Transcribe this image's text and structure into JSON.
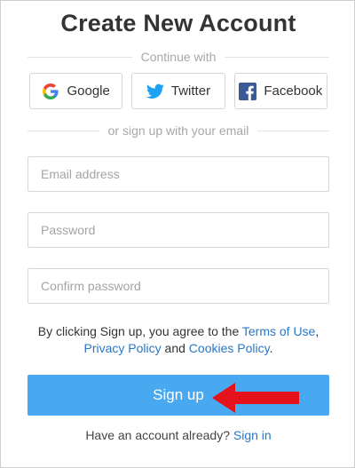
{
  "title": "Create New Account",
  "continue_with": "Continue with",
  "social": {
    "google": "Google",
    "twitter": "Twitter",
    "facebook": "Facebook"
  },
  "or_signup": "or sign up with your email",
  "fields": {
    "email_placeholder": "Email address",
    "password_placeholder": "Password",
    "confirm_placeholder": "Confirm password"
  },
  "terms": {
    "prefix": "By clicking Sign up, you agree to the",
    "terms_link": "Terms of Use",
    "comma": ",",
    "privacy_link": "Privacy Policy",
    "and": "and",
    "cookies_link": "Cookies Policy",
    "period": "."
  },
  "signup_label": "Sign up",
  "footer": {
    "prompt": "Have an account already?",
    "signin_link": "Sign in"
  },
  "icons": {
    "google": "google-icon",
    "twitter": "twitter-icon",
    "facebook": "facebook-icon",
    "annotation": "red-arrow-icon"
  },
  "colors": {
    "accent": "#49a9f0",
    "link": "#2a77c5",
    "arrow": "#e5121b",
    "twitter": "#1da1f2",
    "facebook": "#3b5998"
  }
}
